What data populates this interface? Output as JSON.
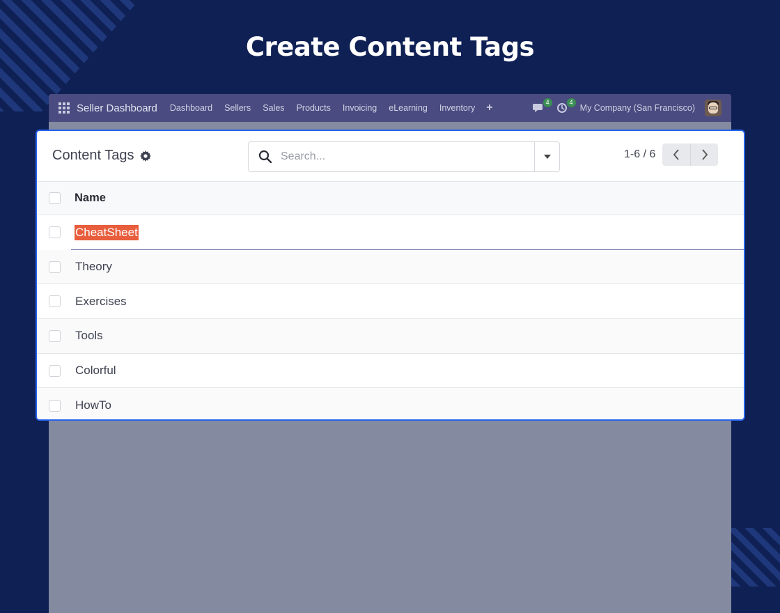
{
  "headline": "Create Content Tags",
  "navbar": {
    "app_name": "Seller Dashboard",
    "menu": [
      "Dashboard",
      "Sellers",
      "Sales",
      "Products",
      "Invoicing",
      "eLearning",
      "Inventory"
    ],
    "plus": "+",
    "messages_badge": "4",
    "activities_badge": "4",
    "company": "My Company (San Francisco)"
  },
  "panel": {
    "title": "Content Tags",
    "search": {
      "placeholder": "Search..."
    },
    "pager": {
      "value": "1-6 / 6"
    },
    "list": {
      "column": "Name",
      "rows": [
        "CheatSheet",
        "Theory",
        "Exercises",
        "Tools",
        "Colorful",
        "HowTo"
      ],
      "editing_row": "CheatSheet"
    }
  },
  "colors": {
    "background": "#0f2054",
    "navbar": "#4a4b80",
    "panel_border": "#2563eb",
    "selection": "#e85d3c"
  }
}
